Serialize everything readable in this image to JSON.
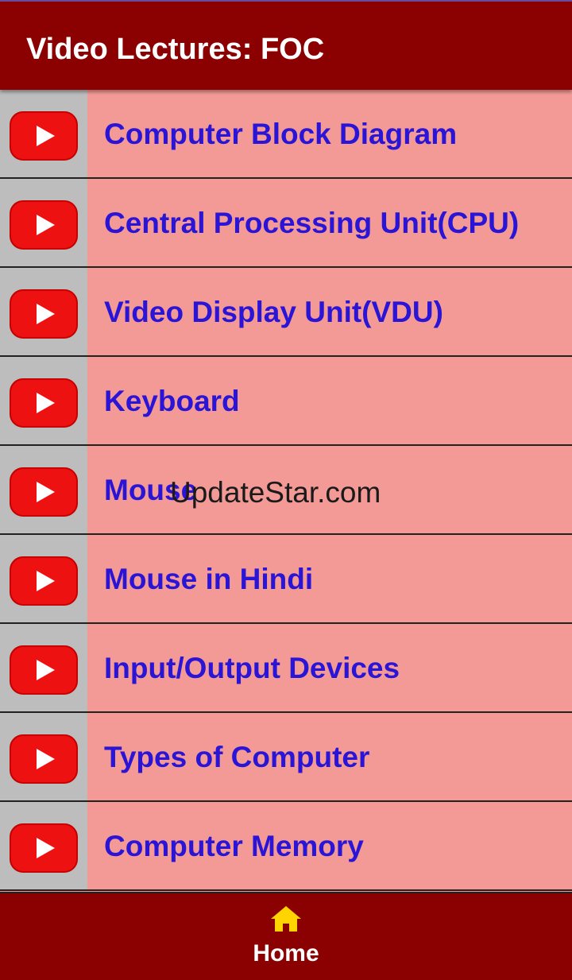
{
  "app": {
    "title": "Video Lectures: FOC",
    "accent_color": "#8b0000",
    "row_color": "#f39a96",
    "link_color": "#2a14d6"
  },
  "lectures": [
    {
      "label": "Computer Block Diagram",
      "icon": "youtube-play-icon"
    },
    {
      "label": "Central Processing Unit(CPU)",
      "icon": "youtube-play-icon"
    },
    {
      "label": "Video Display Unit(VDU)",
      "icon": "youtube-play-icon"
    },
    {
      "label": "Keyboard",
      "icon": "youtube-play-icon"
    },
    {
      "label": "Mouse",
      "icon": "youtube-play-icon"
    },
    {
      "label": "Mouse in Hindi",
      "icon": "youtube-play-icon"
    },
    {
      "label": "Input/Output Devices",
      "icon": "youtube-play-icon"
    },
    {
      "label": "Types of Computer",
      "icon": "youtube-play-icon"
    },
    {
      "label": "Computer Memory",
      "icon": "youtube-play-icon"
    }
  ],
  "watermark": "UpdateStar.com",
  "bottom_nav": {
    "home_label": "Home",
    "home_icon": "home-icon",
    "home_icon_color": "#ffd400"
  }
}
